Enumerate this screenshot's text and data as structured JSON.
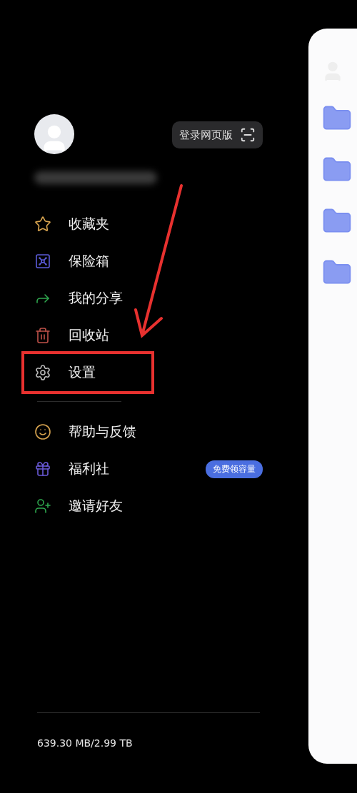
{
  "header": {
    "web_login_button": "登录网页版"
  },
  "menu_primary": [
    {
      "kind": "favorites",
      "label": "收藏夹",
      "highlighted": false
    },
    {
      "kind": "vault",
      "label": "保险箱",
      "highlighted": false
    },
    {
      "kind": "share",
      "label": "我的分享",
      "highlighted": false
    },
    {
      "kind": "trash",
      "label": "回收站",
      "highlighted": false
    },
    {
      "kind": "settings",
      "label": "设置",
      "highlighted": true
    }
  ],
  "menu_secondary": [
    {
      "kind": "help",
      "label": "帮助与反馈"
    },
    {
      "kind": "gift",
      "label": "福利社",
      "badge": "免费领容量"
    },
    {
      "kind": "invite",
      "label": "邀请好友"
    }
  ],
  "storage": "639.30 MB/2.99 TB"
}
